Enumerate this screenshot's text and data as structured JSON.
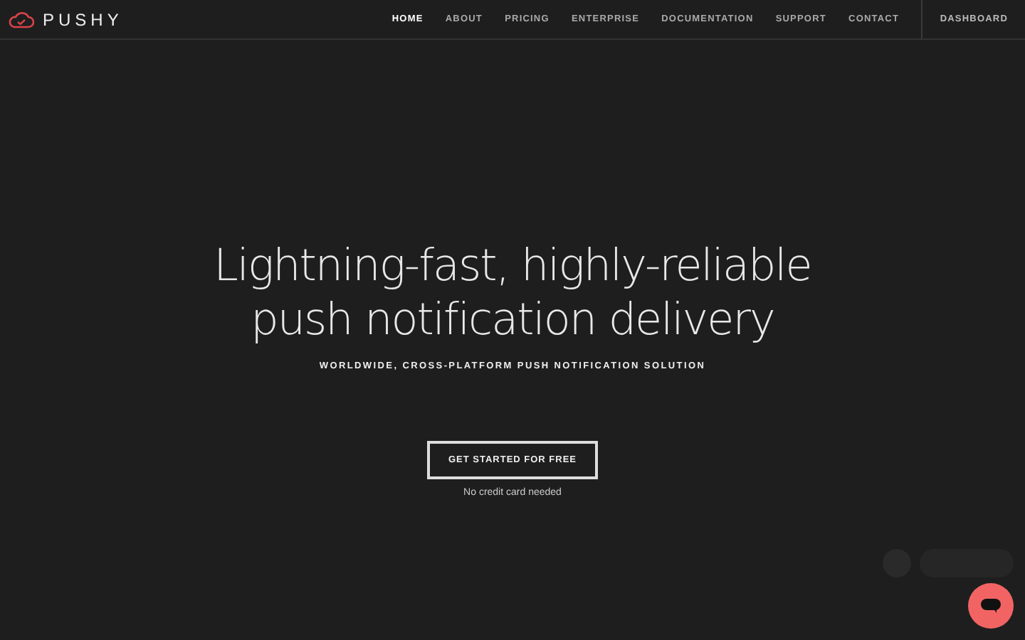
{
  "brand": {
    "name": "PUSHY"
  },
  "nav": [
    {
      "label": "HOME",
      "selected": true
    },
    {
      "label": "ABOUT",
      "selected": false
    },
    {
      "label": "PRICING",
      "selected": false
    },
    {
      "label": "ENTERPRISE",
      "selected": false
    },
    {
      "label": "DOCUMENTATION",
      "selected": false
    },
    {
      "label": "SUPPORT",
      "selected": false
    },
    {
      "label": "CONTACT",
      "selected": false
    }
  ],
  "dashboard": {
    "label": "DASHBOARD"
  },
  "hero": {
    "headline": [
      "Lightning-fast, highly-reliable",
      "push notification delivery"
    ],
    "subtitle": "WORLDWIDE, CROSS-PLATFORM PUSH NOTIFICATION SOLUTION",
    "cta": "GET STARTED FOR FREE",
    "note": "No credit card needed"
  }
}
